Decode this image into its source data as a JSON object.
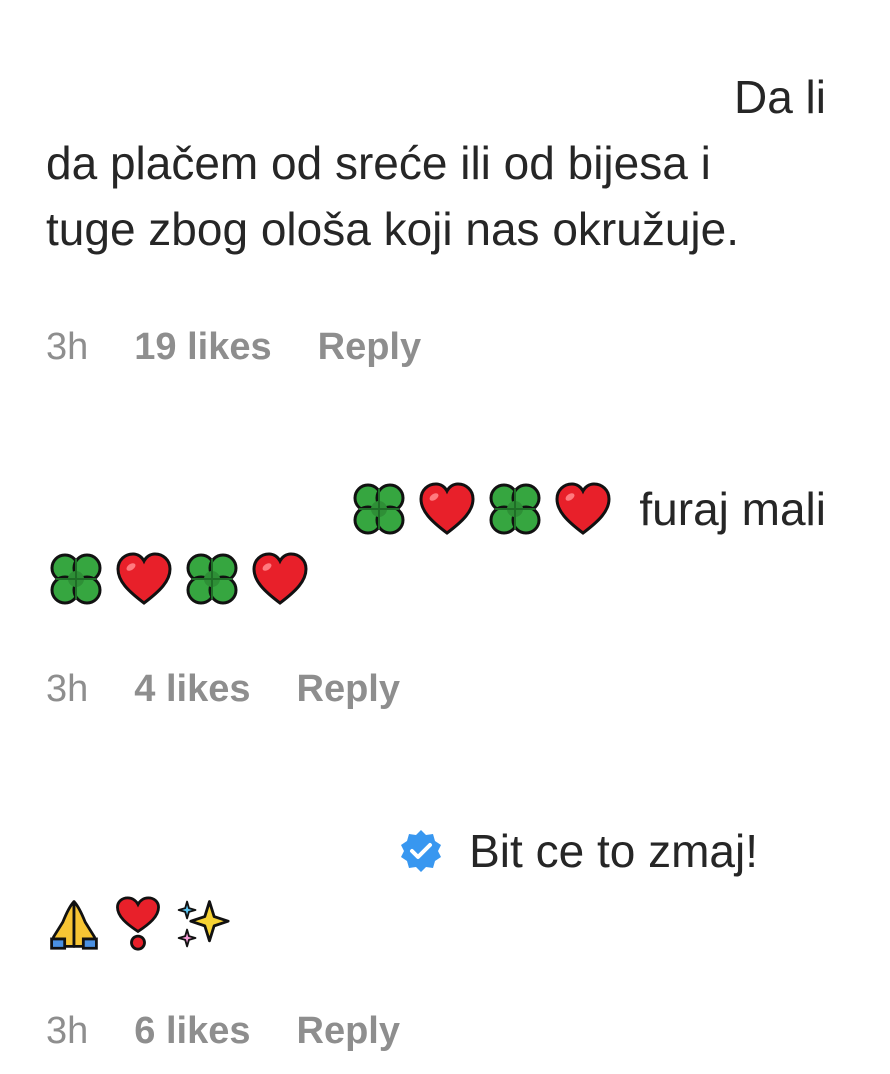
{
  "comments": [
    {
      "line1": "Da li",
      "line2": "da plačem od sreće ili od bijesa i",
      "line3": "tuge zbog ološa koji nas okružuje.",
      "time": "3h",
      "likes": "19 likes",
      "reply": "Reply"
    },
    {
      "text": "furaj mali",
      "time": "3h",
      "likes": "4 likes",
      "reply": "Reply",
      "emojis": [
        "four-leaf-clover",
        "red-heart",
        "four-leaf-clover",
        "red-heart",
        "four-leaf-clover",
        "red-heart",
        "four-leaf-clover",
        "red-heart"
      ]
    },
    {
      "text": "Bit ce to zmaj!",
      "time": "3h",
      "likes": "6 likes",
      "reply": "Reply",
      "emojis": [
        "folded-hands",
        "heart-exclamation",
        "sparkles"
      ]
    }
  ],
  "colors": {
    "text": "#262626",
    "meta": "#8e8e8e",
    "verified": "#3897f0",
    "heart": "#e8202a",
    "clover": "#2e9b3a"
  }
}
